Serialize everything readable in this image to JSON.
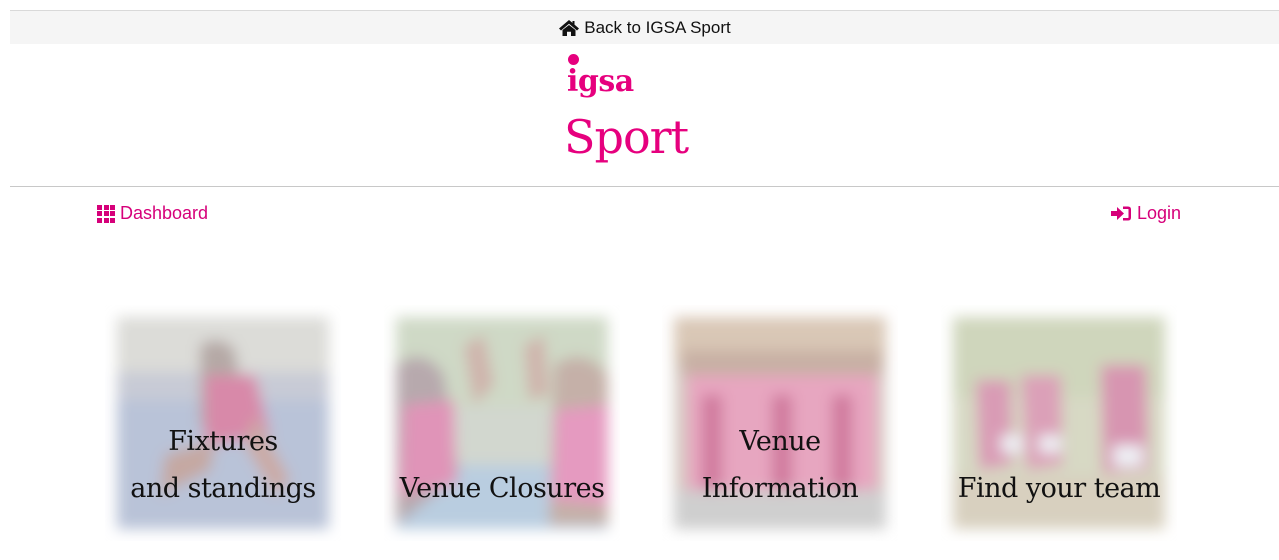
{
  "topbar": {
    "link_label": "Back to IGSA Sport",
    "icon": "home-icon"
  },
  "logo": {
    "line1": "igsa",
    "line2": "Sport"
  },
  "nav": {
    "dashboard_label": "Dashboard",
    "dashboard_icon": "grid-icon",
    "login_label": "Login",
    "login_icon": "sign-in-icon"
  },
  "tiles": [
    {
      "line1": "Fixtures",
      "line2": "and standings"
    },
    {
      "line1": "",
      "line2": "Venue Closures"
    },
    {
      "line1": "Venue",
      "line2": "Information"
    },
    {
      "line1": "",
      "line2": "Find your team"
    }
  ],
  "colors": {
    "brand": "#e6007e",
    "link": "#d6007a"
  }
}
